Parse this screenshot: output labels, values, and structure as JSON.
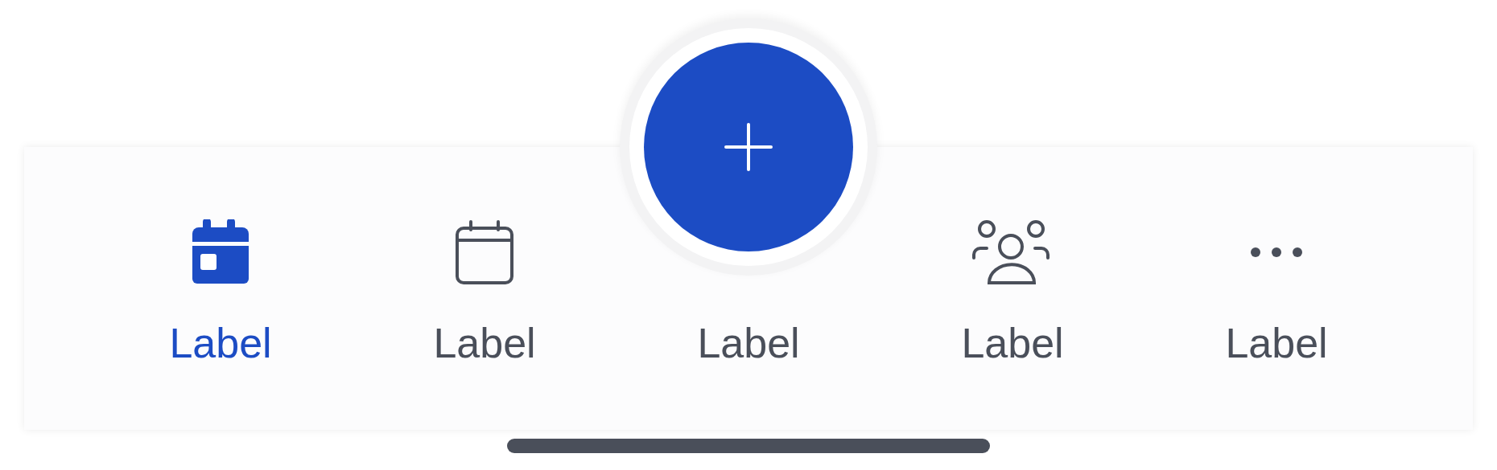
{
  "tab_bar": {
    "items": [
      {
        "kind": "tab",
        "label": "Label",
        "selected": true
      },
      {
        "kind": "tab",
        "label": "Label",
        "selected": false
      },
      {
        "kind": "fab",
        "label": "Label",
        "selected": false
      },
      {
        "kind": "tab",
        "label": "Label",
        "selected": false
      },
      {
        "kind": "tab",
        "label": "Label",
        "selected": false
      }
    ]
  }
}
